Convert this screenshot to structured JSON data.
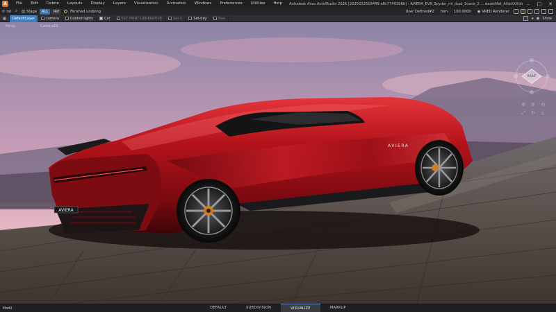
{
  "menubar": {
    "items": [
      "File",
      "Edit",
      "Delete",
      "Layouts",
      "Display",
      "Layers",
      "Visualization",
      "Animation",
      "Windows",
      "Preferences",
      "Utilities",
      "Help"
    ],
    "title": "Autodesk Alias AutoStudio 2026 [2025032518499 a8c7740396b] - AVIERA_EV8_Spyder_ml_dual_Scene_2 ... desktMat_Alias\\XX\\designs\\Modelling\\genesis\\AVIERA_EV8_Spyder_ml_dual_Scene_2.wire*"
  },
  "toolbar": {
    "reset_label": "rst",
    "stage_label": "Stage",
    "chip_all": "ALL",
    "chip_ref": "Ref",
    "status_text": "Finished undoing",
    "user_defined": "User Defined#2",
    "units": "mm",
    "scale": "100.0000",
    "renderer": "VRED Renderer"
  },
  "layers": {
    "items": [
      {
        "label": "DefaultLayer",
        "active": true,
        "checked": false
      },
      {
        "label": "camera",
        "active": false,
        "checked": false
      },
      {
        "label": "Guided lights",
        "active": false,
        "checked": false
      },
      {
        "label": "Car",
        "active": false,
        "checked": true
      },
      {
        "label": "EXT PAINT GENERATIVE",
        "active": false,
        "checked": false,
        "dim": true
      },
      {
        "label": "Set-1",
        "active": false,
        "checked": false,
        "dim": true
      },
      {
        "label": "Set-day",
        "active": false,
        "checked": false
      },
      {
        "label": "Tree",
        "active": false,
        "checked": false,
        "dim": true
      }
    ],
    "right_label": "Show"
  },
  "viewport": {
    "persp_label": "Persp",
    "camera_label": "Camera01",
    "viewcube_label": "RIGHT",
    "badge_rear": "AVIERA",
    "badge_side": "AVIERA"
  },
  "bottombar": {
    "left_label": "Mod2",
    "tabs": [
      "DEFAULT",
      "SUBDIVISION",
      "VISUALIZE",
      "MARKUP"
    ],
    "active_tab": "VISUALIZE"
  },
  "colors": {
    "accent": "#3e7fc4",
    "car_red": "#b3121a",
    "sky_top": "#8d85a8",
    "sky_horizon": "#e9b9c2"
  }
}
